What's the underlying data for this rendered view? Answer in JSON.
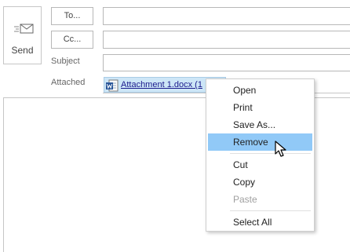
{
  "send": {
    "label": "Send",
    "icon": "send-mail-icon"
  },
  "to": {
    "label": "To...",
    "value": ""
  },
  "cc": {
    "label": "Cc...",
    "value": ""
  },
  "subject": {
    "label": "Subject",
    "value": ""
  },
  "attached": {
    "label": "Attached",
    "filename": "Attachment 1.docx (1",
    "icon": "word-document-icon"
  },
  "context_menu": {
    "items": [
      {
        "label": "Open",
        "state": "normal"
      },
      {
        "label": "Print",
        "state": "normal"
      },
      {
        "label": "Save As...",
        "state": "normal"
      },
      {
        "label": "Remove",
        "state": "hover"
      },
      {
        "label": "Cut",
        "state": "normal"
      },
      {
        "label": "Copy",
        "state": "normal"
      },
      {
        "label": "Paste",
        "state": "disabled"
      },
      {
        "label": "Select All",
        "state": "normal"
      }
    ]
  },
  "colors": {
    "hover": "#91c9f7",
    "attachment_chip": "#cde6f7",
    "word_blue": "#2b579a"
  }
}
